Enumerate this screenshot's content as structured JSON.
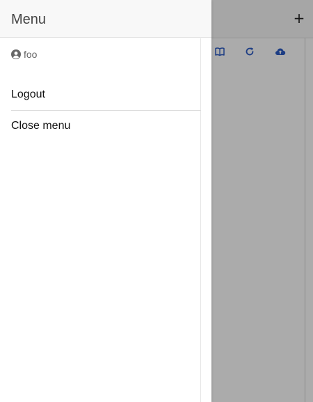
{
  "drawer": {
    "title": "Menu",
    "user": {
      "icon": "user-circle-icon",
      "name": "foo"
    },
    "items": [
      {
        "label": "Logout"
      },
      {
        "label": "Close menu"
      }
    ]
  },
  "background": {
    "add_button_label": "+",
    "toolbar_icons": [
      "book-icon",
      "refresh-icon",
      "cloud-upload-icon"
    ],
    "accent_color": "#2c5cc5"
  },
  "colors": {
    "overlay": "rgba(0,0,0,0.33)",
    "header_bg": "#f8f8f8",
    "text": "#111111",
    "muted_text": "#666666"
  }
}
